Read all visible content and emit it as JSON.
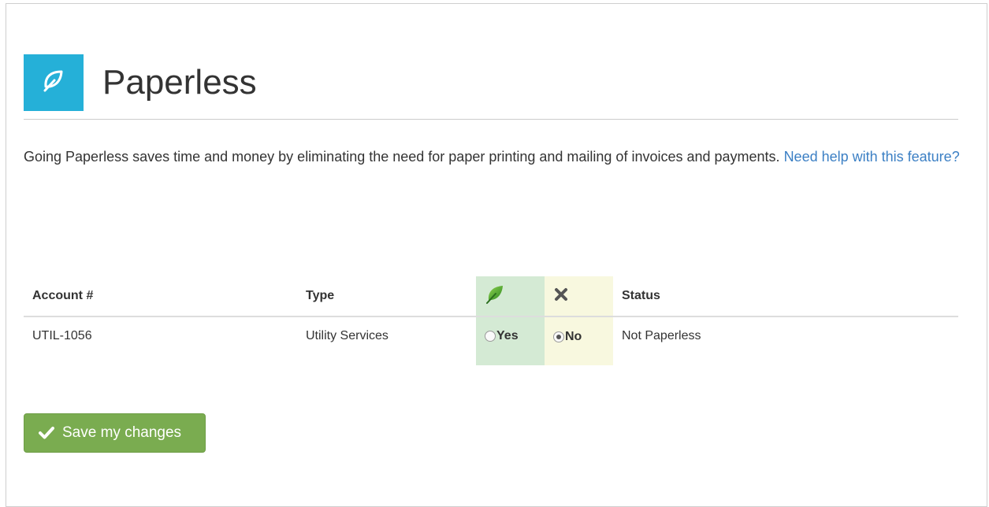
{
  "header": {
    "title": "Paperless",
    "icon": "leaf-icon",
    "icon_bg": "#25b0d8"
  },
  "intro": {
    "text": "Going Paperless saves time and money by eliminating the need for paper printing and mailing of invoices and payments.",
    "help_link": "Need help with this feature?"
  },
  "table": {
    "headers": {
      "account": "Account #",
      "type": "Type",
      "paperless_icon": "green-leaf-icon",
      "not_paperless_icon": "x-icon",
      "status": "Status"
    },
    "rows": [
      {
        "account": "UTIL-1056",
        "type": "Utility Services",
        "yes_label": "Yes",
        "no_label": "No",
        "selected": "No",
        "status": "Not Paperless"
      }
    ],
    "colors": {
      "yes_column": "#d4ead4",
      "no_column": "#f8f8df"
    }
  },
  "save_button": {
    "label": "Save my changes",
    "icon": "check-icon",
    "color": "#7aac50"
  }
}
